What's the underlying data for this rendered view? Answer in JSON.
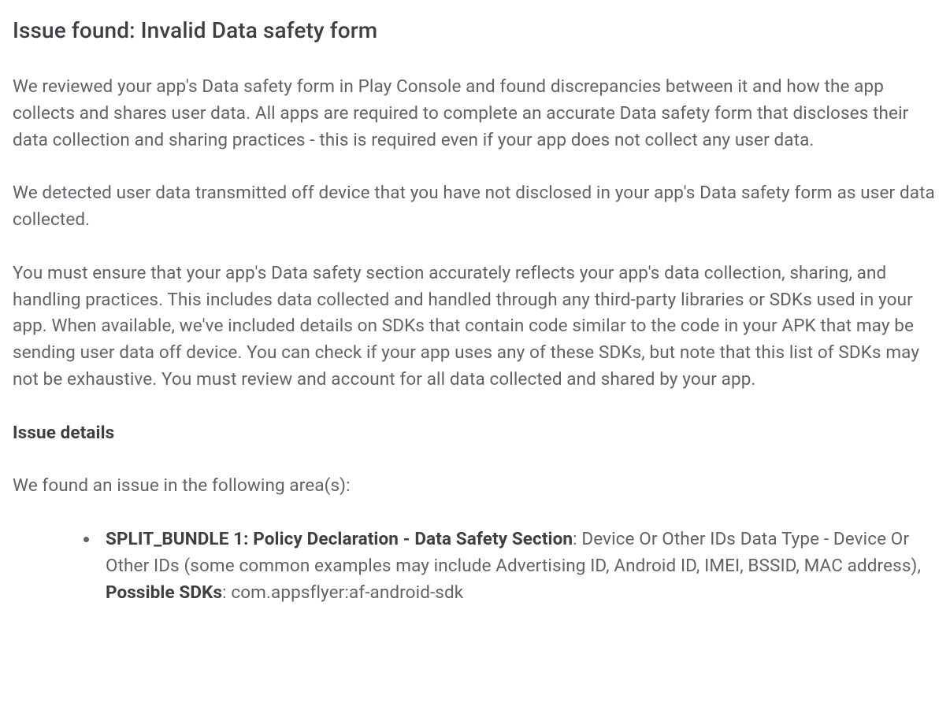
{
  "title": "Issue found: Invalid Data safety form",
  "paragraph1": "We reviewed your app's Data safety form in Play Console and found discrepancies between it and how the app collects and shares user data. All apps are required to complete an accurate Data safety form that discloses their data collection and sharing practices - this is required even if your app does not collect any user data.",
  "paragraph2": "We detected user data transmitted off device that you have not disclosed in your app's Data safety form as user data collected.",
  "paragraph3": "You must ensure that your app's Data safety section accurately reflects your app's data collection, sharing, and handling practices. This includes data collected and handled through any third-party libraries or SDKs used in your app. When available, we've included details on SDKs that contain code similar to the code in your APK that may be sending user data off device. You can check if your app uses any of these SDKs, but note that this list of SDKs may not be exhaustive. You must review and account for all data collected and shared by your app.",
  "issueDetailsHeading": "Issue details",
  "issueDetailsIntro": "We found an issue in the following area(s):",
  "listItem": {
    "boldPrefix": "SPLIT_BUNDLE 1: Policy Declaration - Data Safety Section",
    "text1": ": Device Or Other IDs Data Type - Device Or Other IDs (some common examples may include Advertising ID, Android ID, IMEI, BSSID, MAC address), ",
    "boldMiddle": "Possible SDKs",
    "text2": ": com.appsflyer:af-android-sdk"
  }
}
